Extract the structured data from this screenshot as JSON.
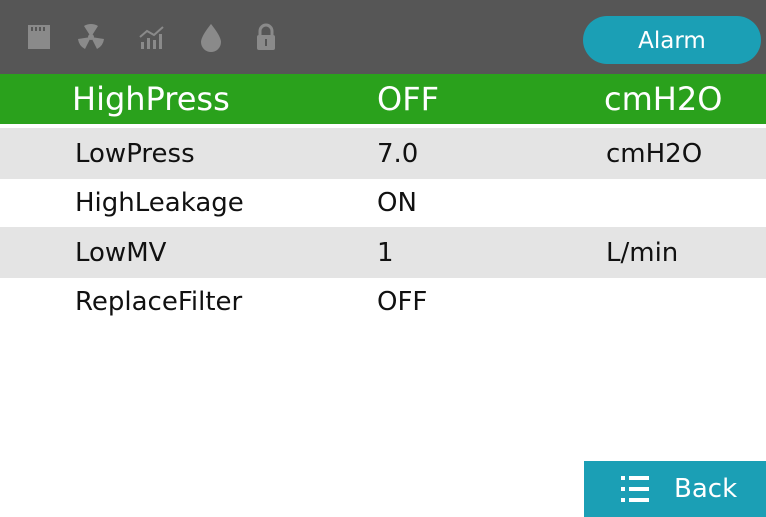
{
  "header": {
    "icons": [
      "sd-card-icon",
      "radiation-icon",
      "trend-chart-icon",
      "water-drop-icon",
      "lock-icon"
    ],
    "alarm_label": "Alarm",
    "icon_color": "#8a8a8a",
    "bar_color": "#565656",
    "accent": "#1b9fb5"
  },
  "alarms": [
    {
      "name": "HighPress",
      "value": "OFF",
      "unit": "cmH2O"
    },
    {
      "name": "LowPress",
      "value": "7.0",
      "unit": "cmH2O"
    },
    {
      "name": "HighLeakage",
      "value": "ON",
      "unit": ""
    },
    {
      "name": "LowMV",
      "value": "1",
      "unit": "L/min"
    },
    {
      "name": "ReplaceFilter",
      "value": "OFF",
      "unit": ""
    }
  ],
  "selected_color": "#2aa11c",
  "stripe_color": "#e4e4e4",
  "footer": {
    "back_label": "Back",
    "back_icon": "list-icon"
  }
}
